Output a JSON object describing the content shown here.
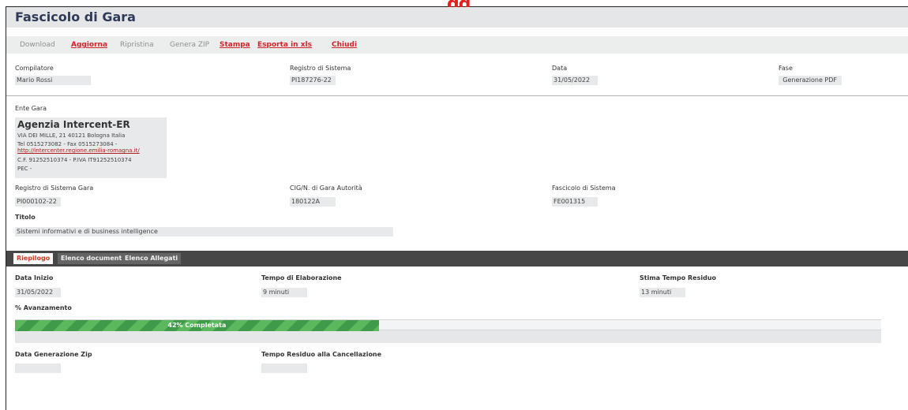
{
  "overlay_mark": "gg",
  "window": {
    "title": "Fascicolo di Gara"
  },
  "toolbar": {
    "download": "Download",
    "aggiorna": "Aggiorna",
    "ripristina": "Ripristina",
    "genera_zip": "Genera ZIP",
    "stampa": "Stampa",
    "esporta": "Esporta in xls",
    "chiudi": "Chiudi"
  },
  "header_fields": {
    "compilatore": {
      "label": "Compilatore",
      "value": "Mario Rossi"
    },
    "registro": {
      "label": "Registro di Sistema",
      "value": "PI187276-22"
    },
    "data": {
      "label": "Data",
      "value": "31/05/2022"
    },
    "fase": {
      "label": "Fase",
      "value": "Generazione PDF"
    }
  },
  "ente": {
    "label": "Ente Gara",
    "name": "Agenzia Intercent-ER",
    "address": "VIA DEI MILLE, 21 40121 Bologna Italia",
    "phone": "Tel 0515273082 - Fax 0515273084 -",
    "website": "http://intercenter.regione.emilia-romagna.it/",
    "tax": "C.F. 91252510374 - P.IVA IT91252510374",
    "pec": "PEC - "
  },
  "gara_fields": {
    "registro_gara": {
      "label": "Registro di Sistema Gara",
      "value": "PI000102-22"
    },
    "cig": {
      "label": "CIG/N. di Gara Autorità",
      "value": "180122A"
    },
    "fascicolo": {
      "label": "Fascicolo di Sistema",
      "value": "FE001315"
    },
    "titolo": {
      "label": "Titolo",
      "value": "Sistemi informativi e di business intelligence"
    }
  },
  "tabs": [
    {
      "label": "Riepilogo",
      "active": true
    },
    {
      "label": "Elenco documenti",
      "active": false
    },
    {
      "label": "Elenco Allegati",
      "active": false
    }
  ],
  "riepilogo": {
    "data_inizio": {
      "label": "Data Inizio",
      "value": "31/05/2022"
    },
    "tempo_elab": {
      "label": "Tempo di Elaborazione",
      "value": "9 minuti"
    },
    "stima": {
      "label": "Stima Tempo Residuo",
      "value": "13 minuti"
    },
    "avanzamento": {
      "label": "% Avanzamento",
      "percent": 42,
      "text": "42% Completata"
    },
    "data_zip": {
      "label": "Data Generazione Zip",
      "value": ""
    },
    "tempo_canc": {
      "label": "Tempo Residuo alla Cancellazione",
      "value": ""
    }
  },
  "colors": {
    "accent": "#d1242a",
    "progress": "#5cb85c",
    "tabbar": "#474747"
  }
}
